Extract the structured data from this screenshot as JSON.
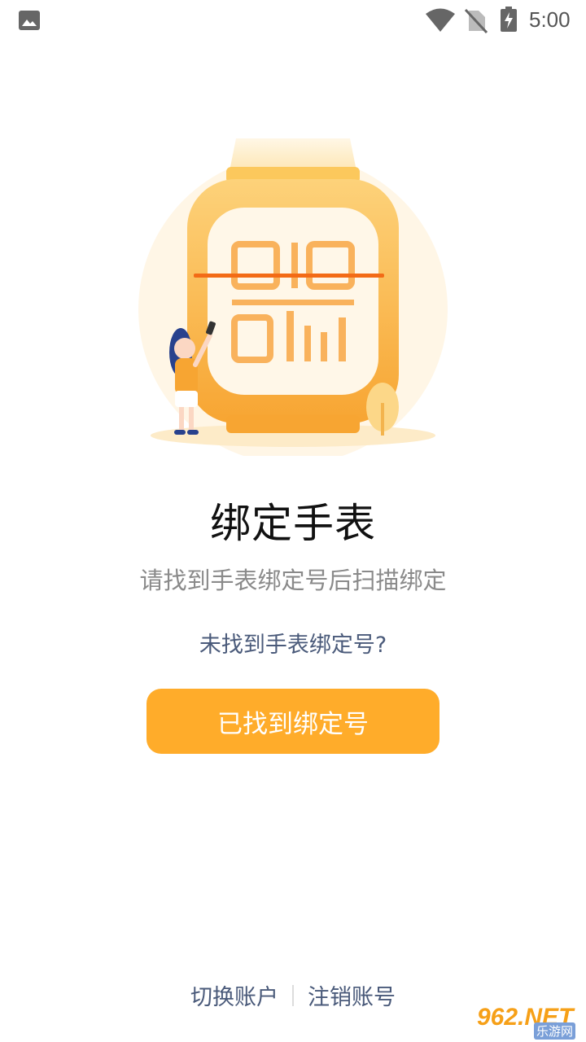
{
  "status_bar": {
    "time": "5:00",
    "icons": [
      "gallery-icon",
      "wifi-icon",
      "no-sim-icon",
      "battery-charging-icon"
    ]
  },
  "illustration": {
    "name": "watch-qr-scan-illustration",
    "colors": {
      "watch": "#fbb43a",
      "scan_line": "#f36b16",
      "background": "#fff3dc"
    }
  },
  "main": {
    "title": "绑定手表",
    "subtitle": "请找到手表绑定号后扫描绑定",
    "help_link": "未找到手表绑定号?",
    "confirm_button": "已找到绑定号"
  },
  "footer": {
    "switch_account": "切换账户",
    "cancel_account": "注销账号"
  },
  "watermark": {
    "brand": "962.NET",
    "sub": "乐游网"
  },
  "colors": {
    "accent": "#ffac2a",
    "link": "#4a5a7a",
    "subtitle": "#8a8a8a"
  }
}
